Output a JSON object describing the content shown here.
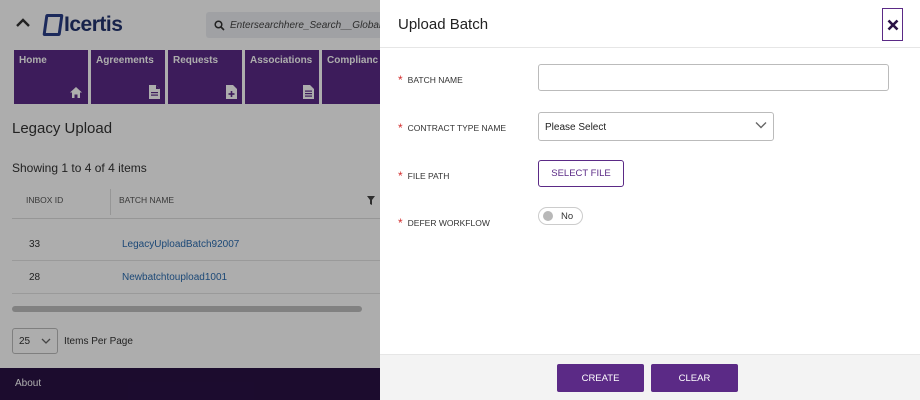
{
  "app": {
    "logo_text": "Icertis",
    "search_placeholder": "Entersearchhere_Search__Global",
    "nav_tiles": [
      {
        "label": "Home",
        "icon": "home-icon"
      },
      {
        "label": "Agreements",
        "icon": "document-icon"
      },
      {
        "label": "Requests",
        "icon": "document-add-icon"
      },
      {
        "label": "Associations",
        "icon": "document-lines-icon"
      },
      {
        "label": "Complianc",
        "icon": "arrow-icon"
      }
    ],
    "page_title": "Legacy Upload",
    "showing_text": "Showing 1 to 4 of 4 items",
    "grid": {
      "columns": [
        "INBOX ID",
        "BATCH NAME"
      ],
      "rows": [
        {
          "inbox_id": "33",
          "batch_name": "LegacyUploadBatch92007"
        },
        {
          "inbox_id": "28",
          "batch_name": "Newbatchtoupload1001"
        }
      ]
    },
    "pager": {
      "page_size": "25",
      "label": "Items Per Page"
    },
    "footer": {
      "about": "About"
    }
  },
  "modal": {
    "title": "Upload Batch",
    "fields": {
      "batch_name": {
        "label": "BATCH NAME",
        "value": ""
      },
      "contract_type": {
        "label": "CONTRACT TYPE NAME",
        "selected": "Please Select"
      },
      "file_path": {
        "label": "FILE PATH",
        "button": "SELECT FILE"
      },
      "defer_workflow": {
        "label": "DEFER WORKFLOW",
        "value": "No"
      }
    },
    "required_mark": "*",
    "buttons": {
      "create": "CREATE",
      "clear": "CLEAR"
    }
  },
  "colors": {
    "brand_purple": "#5b2a86",
    "footer_dark": "#2a1245",
    "required_red": "#d32f2f",
    "link_blue": "#2b6cb0"
  }
}
